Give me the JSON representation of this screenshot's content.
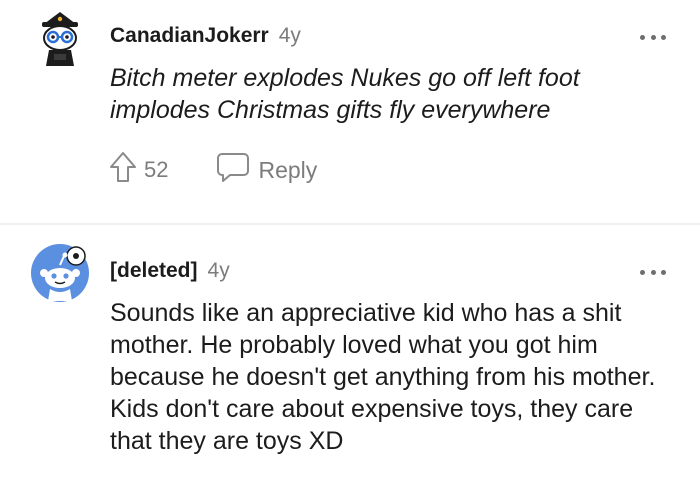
{
  "comments": [
    {
      "username": "CanadianJokerr",
      "age": "4y",
      "body": "Bitch meter explodes Nukes go off left foot implodes Christmas gifts fly everywhere",
      "upvotes": "52",
      "reply_label": "Reply",
      "avatar_icon": "snoo-avatar-hat-glasses-icon"
    },
    {
      "username": "[deleted]",
      "age": "4y",
      "body": "Sounds like an appreciative kid who has a shit mother. He probably loved what you got him because he doesn't get anything from his mother. Kids don't care about expensive toys, they care that they are toys XD",
      "avatar_icon": "default-snoo-avatar-icon"
    }
  ],
  "colors": {
    "text": "#1c1c1c",
    "meta": "#7c7c7c",
    "divider": "#edeff1",
    "default_avatar_bg": "#5b8fe0"
  }
}
